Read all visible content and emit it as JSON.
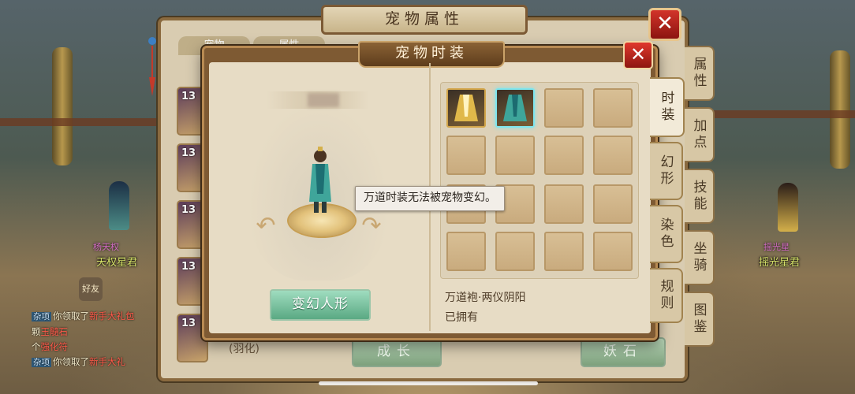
{
  "back_panel": {
    "title": "宠物属性",
    "close_label": "✕",
    "top_tabs": [
      "宠物",
      "属性"
    ],
    "pet_levels": [
      "13",
      "13",
      "13",
      "13",
      "13"
    ],
    "pet_name": "(羽化)",
    "buttons": {
      "grow": "成长",
      "demon_stone": "妖石"
    },
    "right_tabs": [
      "属性",
      "加点",
      "技能",
      "坐骑",
      "图鉴"
    ]
  },
  "dialog": {
    "title": "宠物时装",
    "close_label": "✕",
    "morph_button": "变幻人形",
    "item_name": "万道袍·两仪阴阳",
    "item_status": "已拥有",
    "tooltip": "万道时装无法被宠物变幻。",
    "tabs": [
      "时装",
      "幻形",
      "染色",
      "规则"
    ],
    "active_tab": "时装",
    "grid": {
      "rows": 4,
      "cols": 4,
      "items": [
        "golden-robe",
        "teal-robe"
      ],
      "selected_index": 1
    }
  },
  "scene": {
    "npcs": [
      {
        "name": "天权星君",
        "title": "杨天权"
      },
      {
        "name": "摇光星君",
        "title": "摇光星"
      }
    ],
    "chat": [
      {
        "tag": "杂项",
        "text": "你领取了",
        "red": "新手大礼包"
      },
      {
        "tag": "",
        "text": "颗",
        "red": "玉髓石"
      },
      {
        "tag": "",
        "text": "个",
        "red": "强化符"
      },
      {
        "tag": "杂项",
        "text": "你领取了",
        "red": "新手大礼"
      }
    ],
    "chat_button": "好友"
  },
  "colors": {
    "accent_green": "#7dbf9a",
    "close_red": "#c8281e",
    "tab_brown": "#8d7147"
  }
}
